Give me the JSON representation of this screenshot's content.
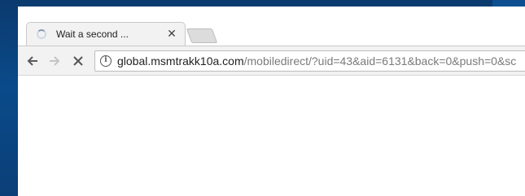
{
  "tab": {
    "title": "Wait a second ...",
    "close_glyph": "✕",
    "loading_icon": "spinner-icon"
  },
  "toolbar": {
    "back_icon": "arrow-left-icon",
    "forward_icon": "arrow-right-icon",
    "stop_icon": "close-icon"
  },
  "omnibox": {
    "info_glyph": "i",
    "url_host": "global.msmtrakk10a.com",
    "url_path": "/mobiledirect/?uid=43&aid=6131&back=0&push=0&sc"
  },
  "colors": {
    "desktop": "#0a4a8a",
    "chrome_toolbar": "#f2f2f2",
    "url_path": "#7a7a7a"
  }
}
